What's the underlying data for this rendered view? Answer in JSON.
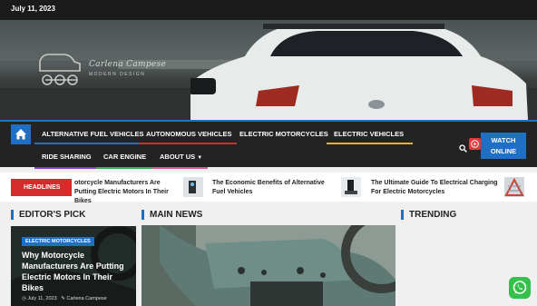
{
  "topbar": {
    "date": "July 11, 2023"
  },
  "logo": {
    "title": "Carlena Campese",
    "subtitle": "MODERN DESIGN"
  },
  "nav": {
    "row1": [
      {
        "label": "ALTERNATIVE FUEL VEHICLES",
        "color": "#1f6fc5"
      },
      {
        "label": "AUTONOMOUS VEHICLES",
        "color": "#d62b2b"
      },
      {
        "label": "ELECTRIC MOTORCYCLES",
        "color": "#232323"
      },
      {
        "label": "ELECTRIC VEHICLES",
        "color": "#e3b12a"
      }
    ],
    "row2": [
      {
        "label": "RIDE SHARING",
        "color": "#8c3bd6"
      },
      {
        "label": "CAR ENGINE",
        "color": "#34b54a"
      },
      {
        "label": "ABOUT US",
        "color": "#e0579a"
      }
    ],
    "watch_label": "WATCH ONLINE"
  },
  "ticker": {
    "label": "HEADLINES",
    "items": [
      "otorcycle Manufacturers Are Putting Electric Motors In Their Bikes",
      "The Economic Benefits of Alternative Fuel Vehicles",
      "The Ultimate Guide To Electrical Charging For Electric Motorcycles"
    ]
  },
  "sections": {
    "editors_pick": "EDITOR'S PICK",
    "main_news": "MAIN NEWS",
    "trending": "TRENDING"
  },
  "editors_card": {
    "category": "ELECTRIC MOTORCYCLES",
    "title": "Why Motorcycle Manufacturers Are Putting Electric Motors In Their Bikes",
    "date": "July 11, 2023",
    "author": "Carlena Campese"
  },
  "colors": {
    "accent": "#1f6fc5",
    "headline_red": "#d62b2b"
  }
}
